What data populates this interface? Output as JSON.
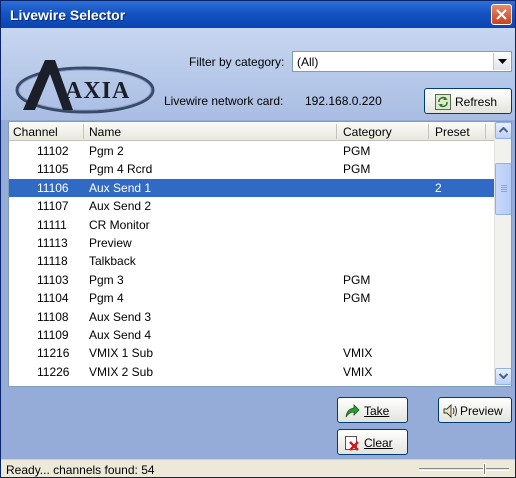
{
  "window": {
    "title": "Livewire Selector"
  },
  "logo": {
    "text": "AXIA"
  },
  "filter": {
    "label": "Filter by category:",
    "selected": "(All)"
  },
  "network": {
    "label": "Livewire network card:",
    "value": "192.168.0.220"
  },
  "buttons": {
    "refresh_label": "Refresh",
    "take_label": "Take",
    "clear_label": "Clear",
    "preview_label": "Preview"
  },
  "list": {
    "columns": [
      "Channel",
      "Name",
      "Category",
      "Preset"
    ],
    "rows": [
      {
        "channel": "11102",
        "name": "Pgm 2",
        "category": "PGM",
        "preset": ""
      },
      {
        "channel": "11105",
        "name": "Pgm 4 Rcrd",
        "category": "PGM",
        "preset": ""
      },
      {
        "channel": "11106",
        "name": "Aux Send 1",
        "category": "",
        "preset": "2",
        "selected": true
      },
      {
        "channel": "11107",
        "name": "Aux Send 2",
        "category": "",
        "preset": ""
      },
      {
        "channel": "11111",
        "name": "CR Monitor",
        "category": "",
        "preset": ""
      },
      {
        "channel": "11113",
        "name": "Preview",
        "category": "",
        "preset": ""
      },
      {
        "channel": "11118",
        "name": "Talkback",
        "category": "",
        "preset": ""
      },
      {
        "channel": "11103",
        "name": "Pgm 3",
        "category": "PGM",
        "preset": ""
      },
      {
        "channel": "11104",
        "name": "Pgm 4",
        "category": "PGM",
        "preset": ""
      },
      {
        "channel": "11108",
        "name": "Aux Send 3",
        "category": "",
        "preset": ""
      },
      {
        "channel": "11109",
        "name": "Aux Send 4",
        "category": "",
        "preset": ""
      },
      {
        "channel": "11216",
        "name": "VMIX 1 Sub",
        "category": "VMIX",
        "preset": ""
      },
      {
        "channel": "11226",
        "name": "VMIX 2 Sub",
        "category": "VMIX",
        "preset": ""
      }
    ]
  },
  "status": {
    "text": "Ready... channels found: 54"
  },
  "colors": {
    "titlebar": "#0b44b2",
    "selection": "#316ac5",
    "window_bg": "#95acd8"
  }
}
